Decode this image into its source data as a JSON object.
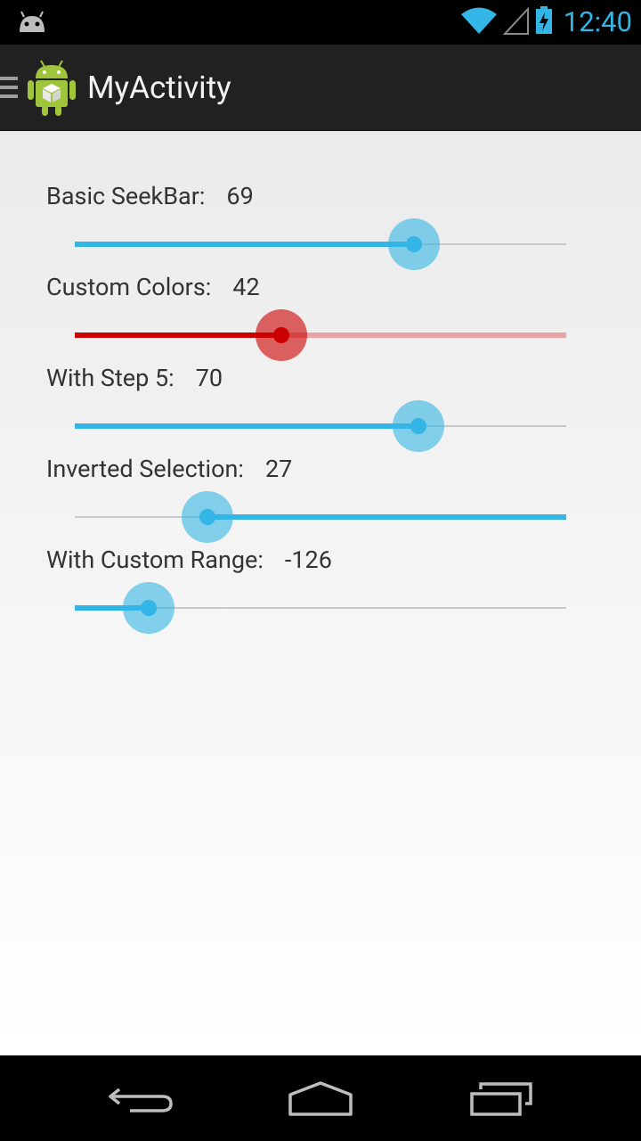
{
  "status_bar": {
    "time": "12:40",
    "left_icon": "android-notification-icon",
    "icons": [
      "wifi-icon",
      "signal-icon",
      "battery-charging-icon"
    ]
  },
  "action_bar": {
    "title": "MyActivity",
    "drawer_icon": "drawer-menu-icon",
    "app_icon": "android-app-icon"
  },
  "seekbars": [
    {
      "label": "Basic SeekBar:",
      "value": "69",
      "progress": 0.69,
      "color": "#33b5e5",
      "inverted": false
    },
    {
      "label": "Custom Colors:",
      "value": "42",
      "progress": 0.42,
      "color": "#cc0000",
      "track_color": "#e8a3a3",
      "inverted": false
    },
    {
      "label": "With Step 5:",
      "value": "70",
      "progress": 0.7,
      "color": "#33b5e5",
      "inverted": false
    },
    {
      "label": "Inverted Selection:",
      "value": "27",
      "progress": 0.27,
      "color": "#33b5e5",
      "inverted": true
    },
    {
      "label": "With Custom Range:",
      "value": "-126",
      "progress": 0.15,
      "color": "#33b5e5",
      "inverted": false
    }
  ],
  "nav_bar": {
    "back_icon": "back-icon",
    "home_icon": "home-icon",
    "recents_icon": "recents-icon"
  }
}
